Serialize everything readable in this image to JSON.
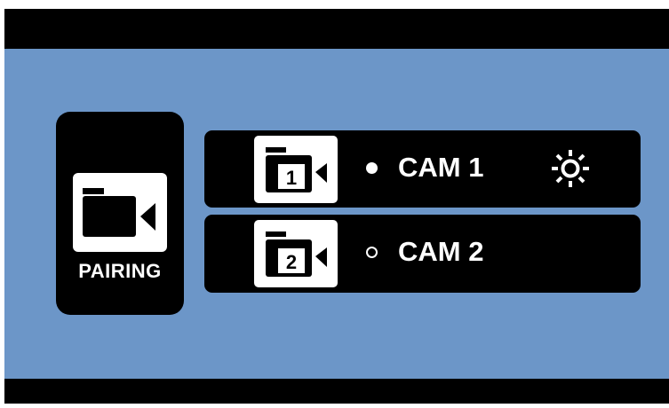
{
  "pairing": {
    "label": "PAIRING",
    "icon": "video-camera-icon"
  },
  "cameras": [
    {
      "label": "CAM 1",
      "number": "1",
      "status": "active",
      "status_icon": "filled-dot-icon",
      "icon": "video-camera-numbered-icon",
      "settings_icon": "brightness-icon"
    },
    {
      "label": "CAM 2",
      "number": "2",
      "status": "inactive",
      "status_icon": "hollow-dot-icon",
      "icon": "video-camera-numbered-icon"
    }
  ],
  "colors": {
    "panel_background": "#6c96c8",
    "frame": "#000000",
    "foreground": "#ffffff"
  }
}
